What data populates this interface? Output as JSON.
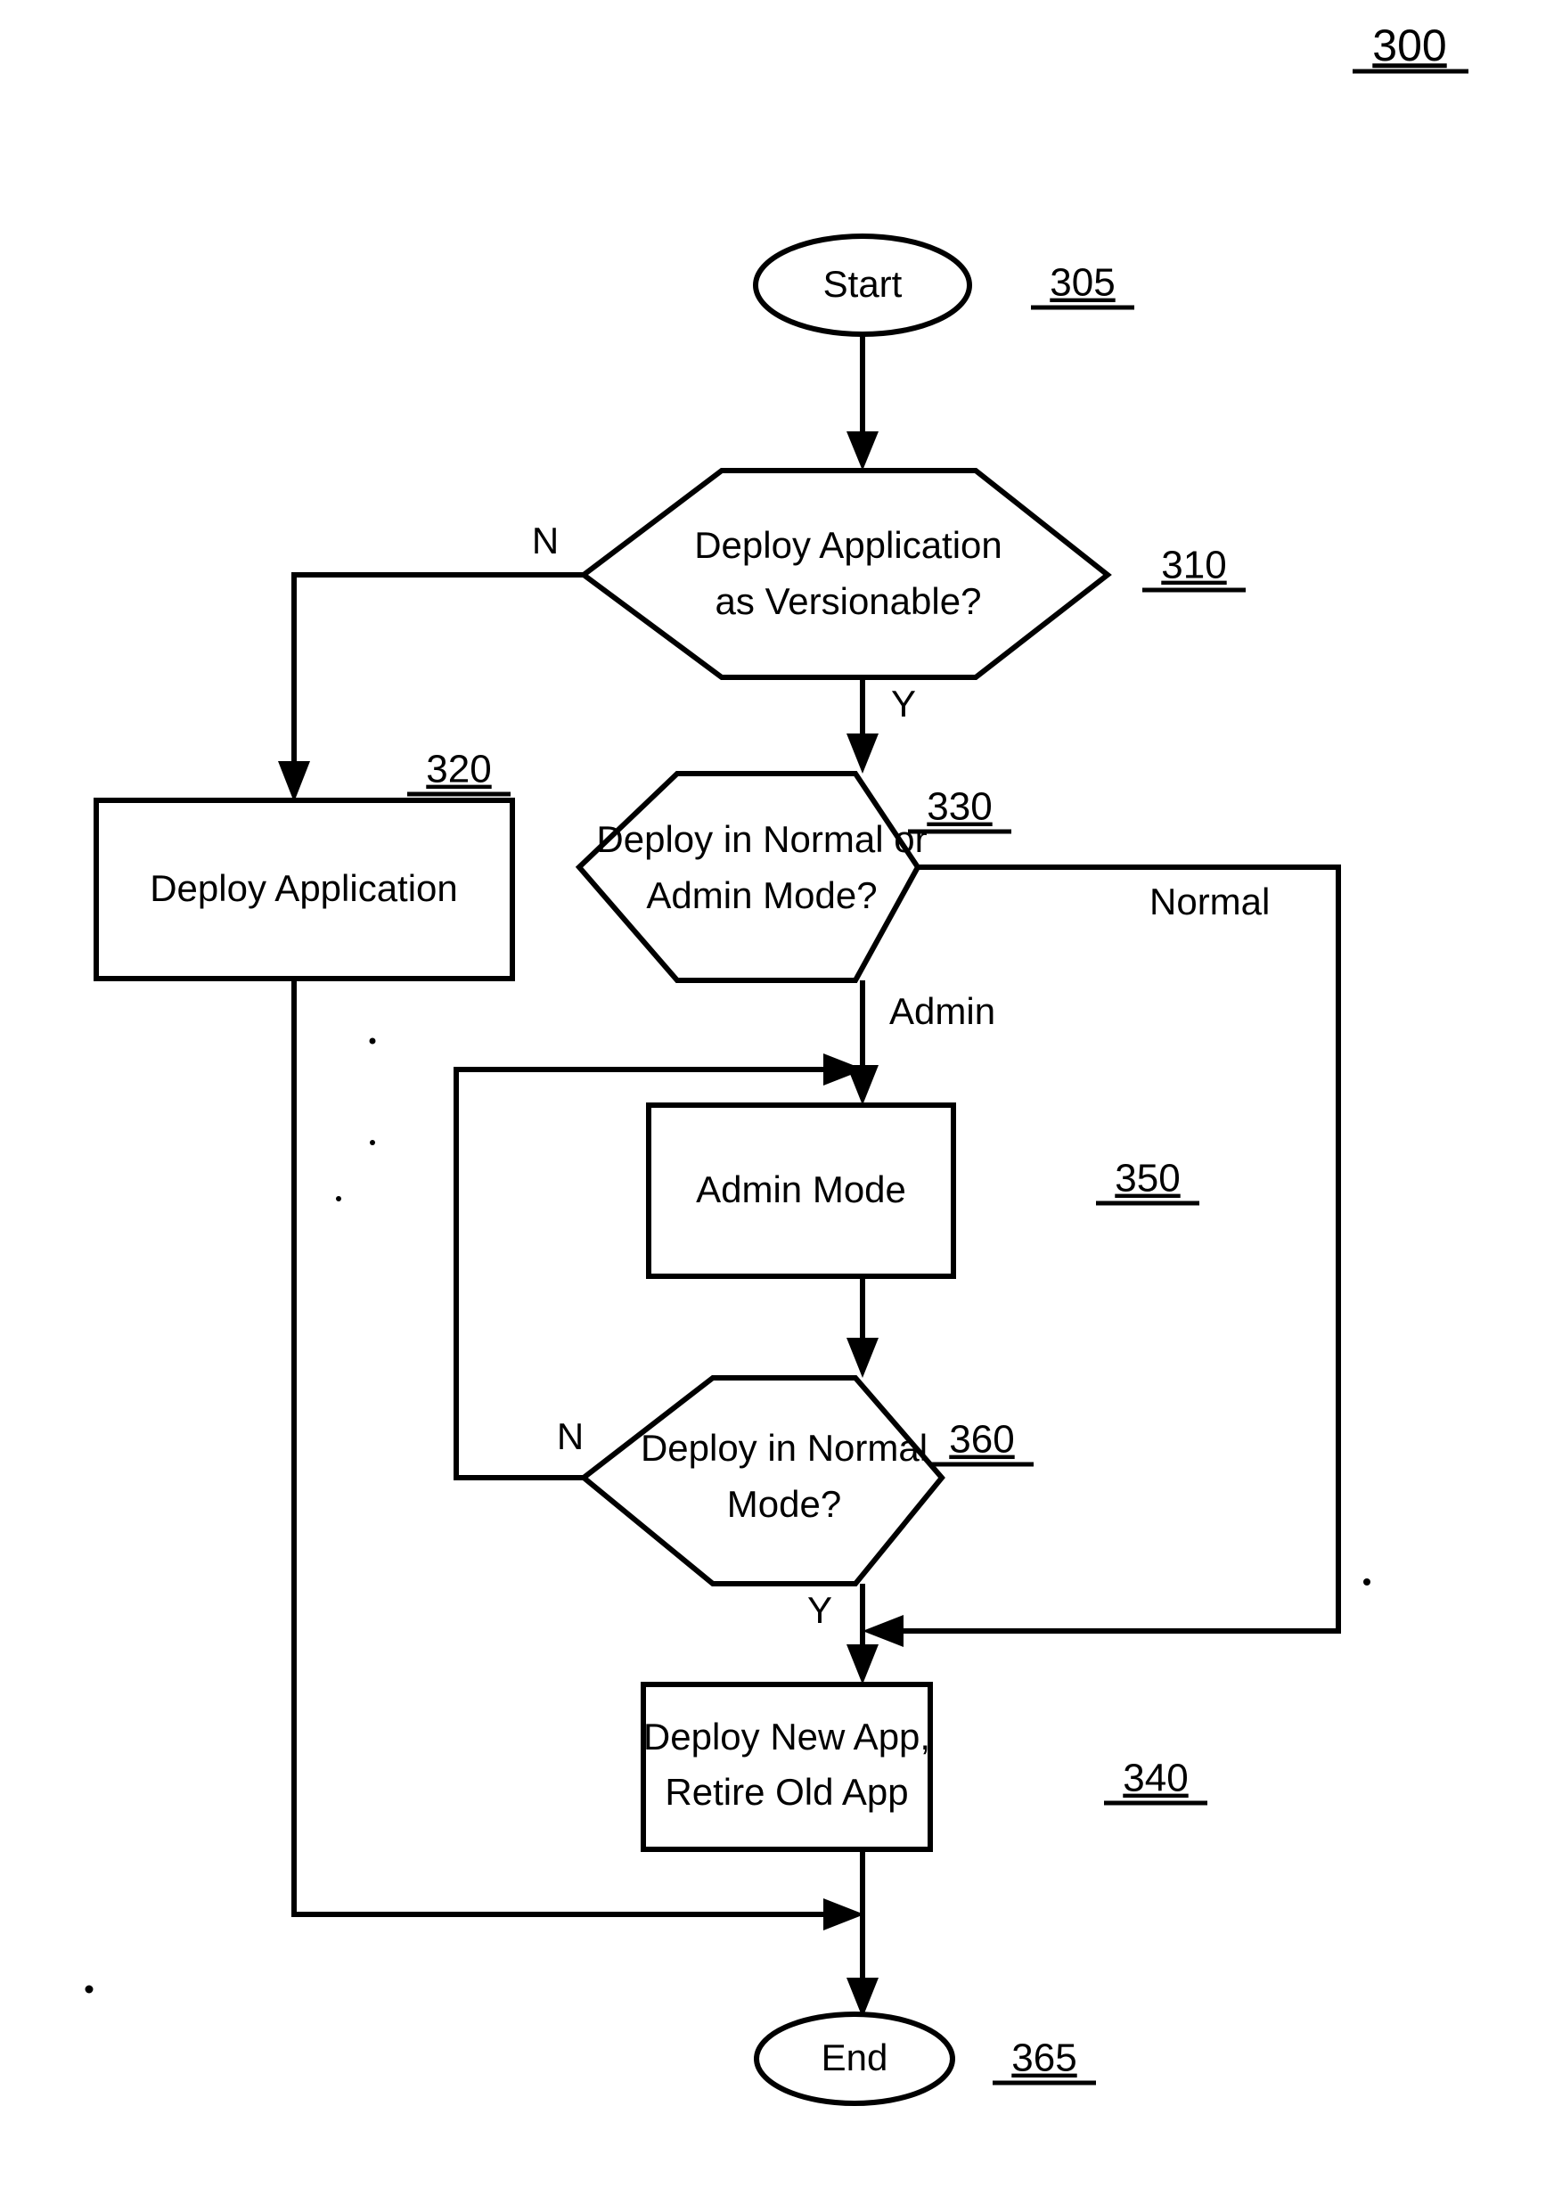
{
  "figure": {
    "number": "300"
  },
  "nodes": {
    "start": {
      "label": "Start",
      "ref": "305"
    },
    "decision_versionable": {
      "label_line1": "Deploy Application",
      "label_line2": "as Versionable?",
      "ref": "310"
    },
    "deploy_application": {
      "label": "Deploy Application",
      "ref": "320"
    },
    "decision_mode": {
      "label_line1": "Deploy in Normal or",
      "label_line2": "Admin Mode?",
      "ref": "330"
    },
    "admin_mode": {
      "label": "Admin Mode",
      "ref": "350"
    },
    "decision_normal_mode": {
      "label_line1": "Deploy in Normal",
      "label_line2": "Mode?",
      "ref": "360"
    },
    "deploy_new_app": {
      "label_line1": "Deploy New App,",
      "label_line2": "Retire Old App",
      "ref": "340"
    },
    "end": {
      "label": "End",
      "ref": "365"
    }
  },
  "edge_labels": {
    "versionable_no": "N",
    "versionable_yes": "Y",
    "mode_normal": "Normal",
    "mode_admin": "Admin",
    "normal_mode_no": "N",
    "normal_mode_yes": "Y"
  },
  "colors": {
    "stroke": "#000000",
    "fill": "#ffffff",
    "background": "#ffffff"
  },
  "chart_data": {
    "type": "diagram",
    "title": "300",
    "diagram_kind": "flowchart",
    "nodes": [
      {
        "id": "305",
        "type": "terminator",
        "text": "Start"
      },
      {
        "id": "310",
        "type": "decision",
        "text": "Deploy Application as Versionable?"
      },
      {
        "id": "320",
        "type": "process",
        "text": "Deploy Application"
      },
      {
        "id": "330",
        "type": "decision",
        "text": "Deploy in Normal or Admin Mode?"
      },
      {
        "id": "350",
        "type": "process",
        "text": "Admin Mode"
      },
      {
        "id": "360",
        "type": "decision",
        "text": "Deploy in Normal Mode?"
      },
      {
        "id": "340",
        "type": "process",
        "text": "Deploy New App, Retire Old App"
      },
      {
        "id": "365",
        "type": "terminator",
        "text": "End"
      }
    ],
    "edges": [
      {
        "from": "305",
        "to": "310",
        "label": ""
      },
      {
        "from": "310",
        "to": "320",
        "label": "N"
      },
      {
        "from": "310",
        "to": "330",
        "label": "Y"
      },
      {
        "from": "330",
        "to": "350",
        "label": "Admin"
      },
      {
        "from": "330",
        "to": "340",
        "label": "Normal"
      },
      {
        "from": "350",
        "to": "360",
        "label": ""
      },
      {
        "from": "360",
        "to": "350",
        "label": "N"
      },
      {
        "from": "360",
        "to": "340",
        "label": "Y"
      },
      {
        "from": "340",
        "to": "365",
        "label": ""
      },
      {
        "from": "320",
        "to": "365",
        "label": ""
      }
    ]
  }
}
